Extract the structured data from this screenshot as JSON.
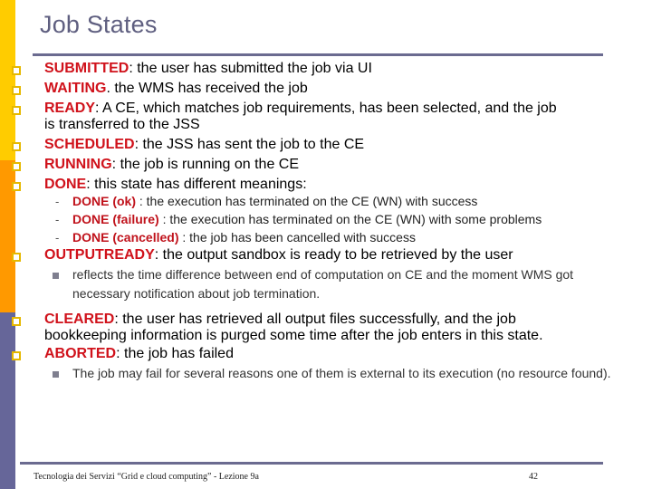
{
  "slide": {
    "title": "Job States",
    "accent_colors": {
      "band_top": "#FFCC00",
      "band_middle": "#FF9900",
      "band_bottom": "#666699",
      "keyword": "#D0121B",
      "rule": "#6B6B90",
      "bullet": "#E6B800"
    }
  },
  "states": [
    {
      "name": "SUBMITTED",
      "sep": ": ",
      "text": "the user has submitted the job via UI",
      "line2": ""
    },
    {
      "name": "WAITING",
      "sep": ". ",
      "text": "the WMS has received the job",
      "line2": ""
    },
    {
      "name": "READY",
      "sep": ": ",
      "text": "A CE, which matches job requirements, has been selected, and the job",
      "line2": "is transferred to the JSS"
    },
    {
      "name": "SCHEDULED",
      "sep": ": ",
      "text": "the JSS has sent the job to the CE",
      "line2": ""
    },
    {
      "name": "RUNNING",
      "sep": ": ",
      "text": "the job is running on the CE",
      "line2": ""
    },
    {
      "name": "DONE",
      "sep": ": ",
      "text": "this state has different meanings:",
      "line2": ""
    },
    {
      "name": "OUTPUTREADY",
      "sep": ": ",
      "text": "the output sandbox is ready to be retrieved by the user",
      "line2": ""
    },
    {
      "name": "CLEARED",
      "sep": ": ",
      "text": "the user has retrieved all output files successfully, and the job",
      "line2": "bookkeeping information is purged some time after the job enters in this state."
    },
    {
      "name": "ABORTED",
      "sep": ": ",
      "text": "the job has failed",
      "line2": ""
    }
  ],
  "done_substates": [
    {
      "name": "DONE (ok)",
      "text": " : the execution has terminated on the CE (WN) with success"
    },
    {
      "name": "DONE (failure)",
      "text": " : the execution has terminated on the CE (WN) with some problems"
    },
    {
      "name": "DONE (cancelled)",
      "text": " : the job has been cancelled with success"
    }
  ],
  "notes": {
    "outputready": "reflects the time difference between end of computation on CE and the moment WMS got necessary notification  about job termination.",
    "aborted": "The job may fail for several reasons one of them is external to its execution (no resource found)."
  },
  "sub_marker": "-",
  "footer": {
    "text": "Tecnologia dei Servizi “Grid e cloud computing” - Lezione 9a",
    "page": "42"
  }
}
